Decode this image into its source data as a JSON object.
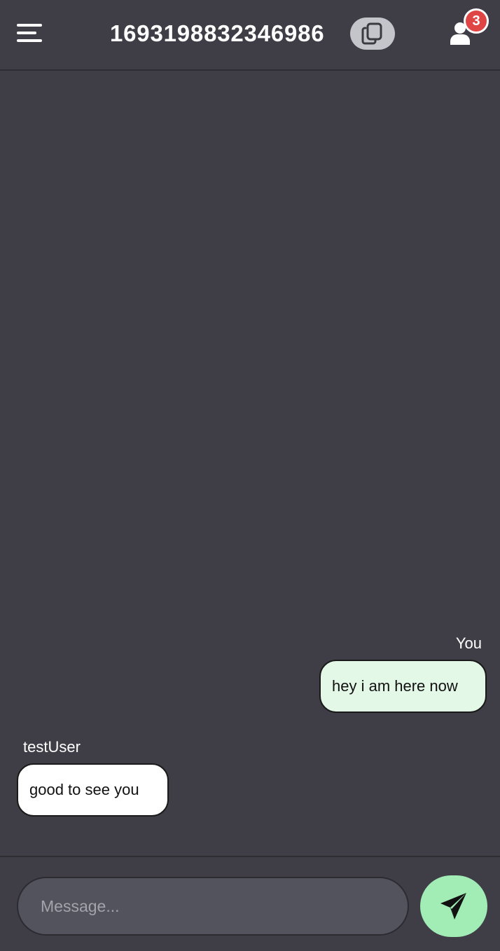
{
  "header": {
    "menu_icon": "hamburger-menu-icon",
    "room_id": "1693198832346986",
    "copy_icon": "copy-icon",
    "users_icon": "user-icon",
    "user_count": "3",
    "badge_color": "#e04545"
  },
  "messages": [
    {
      "sender": "You",
      "text": "hey i am here now",
      "own": true,
      "bubble_color": "#e4f8e8"
    },
    {
      "sender": "testUser",
      "text": "good to see you",
      "own": false,
      "bubble_color": "#ffffff"
    }
  ],
  "composer": {
    "placeholder": "Message...",
    "value": "",
    "send_icon": "paper-plane-icon",
    "send_color": "#a2ecb5"
  },
  "theme": {
    "background": "#3f3e46"
  }
}
